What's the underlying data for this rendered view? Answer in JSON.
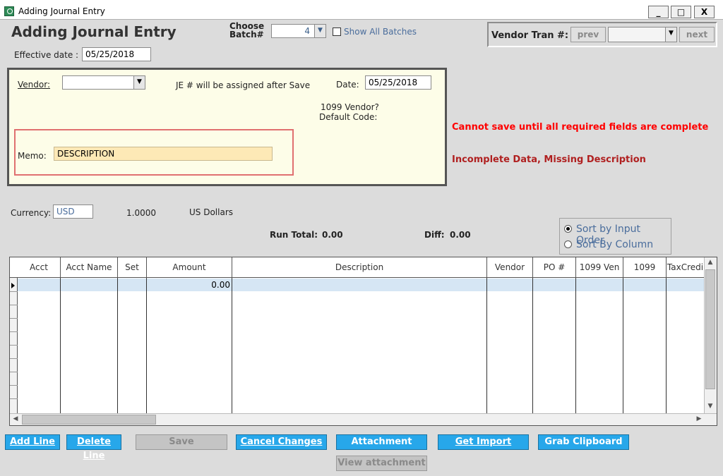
{
  "window": {
    "title": "Adding Journal Entry",
    "min": "_",
    "max": "□",
    "close": "X"
  },
  "header": {
    "heading": "Adding Journal Entry",
    "choose_batch_line1": "Choose",
    "choose_batch_line2": "Batch#",
    "batch_value": "4",
    "show_all_batches": "Show All Batches",
    "effective_date_label": "Effective date :",
    "effective_date": "05/25/2018"
  },
  "vendor_tran": {
    "label": "Vendor Tran #:",
    "prev": "prev",
    "next": "next",
    "value": ""
  },
  "vendor_panel": {
    "vendor_label": "Vendor:",
    "vendor_value": "",
    "je_note": "JE # will be assigned after Save",
    "date_label": "Date:",
    "date_value": "05/25/2018",
    "vendor_1099": "1099 Vendor?",
    "default_code": "Default Code:",
    "memo_label": "Memo:",
    "memo_value": "DESCRIPTION"
  },
  "messages": {
    "error": "Cannot save until all required fields are complete",
    "incomplete": "Incomplete Data, Missing Description"
  },
  "currency": {
    "label": "Currency:",
    "code": "USD",
    "rate": "1.0000",
    "name": "US Dollars"
  },
  "totals": {
    "run_total_label": "Run Total:",
    "run_total": "0.00",
    "diff_label": "Diff:",
    "diff": "0.00"
  },
  "sort": {
    "input_order": "Sort by Input Order",
    "by_column": "Sort By Column",
    "selected": "input_order"
  },
  "grid": {
    "columns": [
      "Acct",
      "Acct Name",
      "Set",
      "Amount",
      "Description",
      "Vendor",
      "PO #",
      "1099 Ven",
      "1099",
      "TaxCredi"
    ],
    "rows": [
      [
        "",
        "",
        "",
        "0.00",
        "",
        "",
        "",
        "",
        "",
        ""
      ]
    ]
  },
  "buttons": {
    "add_line": "Add Line",
    "delete_line": "Delete Line",
    "save": "Save",
    "cancel_changes": "Cancel Changes",
    "attachment": "Attachment",
    "get_import": "Get Import",
    "grab_clipboard": "Grab Clipboard",
    "view_attachment": "View attachment"
  }
}
